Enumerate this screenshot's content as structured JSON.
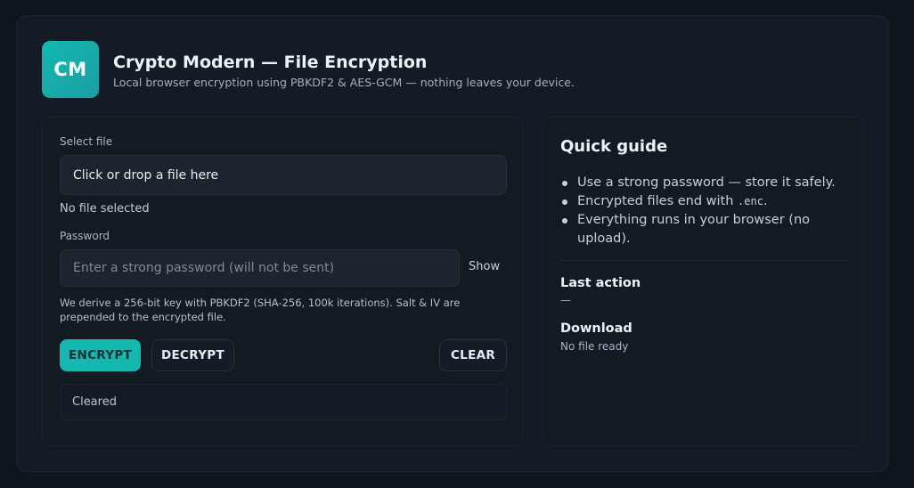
{
  "header": {
    "logo_text": "CM",
    "title": "Crypto Modern — File Encryption",
    "subtitle": "Local browser encryption using PBKDF2 & AES-GCM — nothing leaves your device."
  },
  "form": {
    "file_label": "Select file",
    "file_drop_text": "Click or drop a file here",
    "file_status": "No file selected",
    "password_label": "Password",
    "password_placeholder": "Enter a strong password (will not be sent)",
    "password_value": "",
    "show_label": "Show",
    "note": "We derive a 256-bit key with PBKDF2 (SHA-256, 100k iterations). Salt & IV are prepended to the encrypted file.",
    "encrypt_label": "ENCRYPT",
    "decrypt_label": "DECRYPT",
    "clear_label": "CLEAR",
    "status": "Cleared"
  },
  "guide": {
    "title": "Quick guide",
    "items": [
      {
        "text": "Use a strong password — store it safely."
      },
      {
        "pre": "Encrypted files end with ",
        "code": ".enc",
        "post": "."
      },
      {
        "text": "Everything runs in your browser (no upload)."
      }
    ],
    "last_action_title": "Last action",
    "last_action_value": "—",
    "download_title": "Download",
    "download_value": "No file ready"
  },
  "colors": {
    "accent": "#14b8b0",
    "background": "#0e151c",
    "panel": "#131c24"
  }
}
